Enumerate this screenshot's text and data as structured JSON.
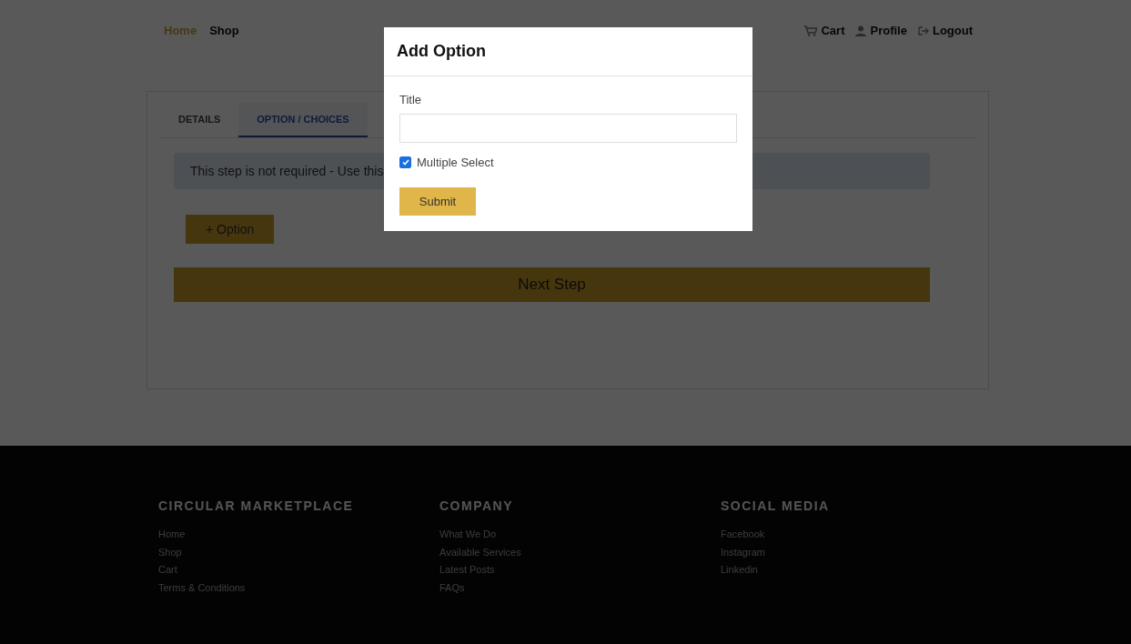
{
  "nav": {
    "links": [
      {
        "label": "Home",
        "selected": true
      },
      {
        "label": "Shop",
        "selected": false
      }
    ],
    "actions": [
      {
        "label": "Cart",
        "kind": "cart"
      },
      {
        "label": "Profile",
        "kind": "profile"
      },
      {
        "label": "Logout",
        "kind": "logout"
      }
    ]
  },
  "tabs": [
    {
      "label": "DETAILS",
      "selected": false
    },
    {
      "label": "OPTION / CHOICES",
      "selected": true
    }
  ],
  "alert": "This step is not required - Use this",
  "add_option_button": "+ Option",
  "next_button": "Next Step",
  "modal": {
    "title": "Add Option",
    "field": {
      "label": "Title"
    },
    "multiple_select": {
      "label": "Multiple Select",
      "checked": true
    },
    "submit": "Submit"
  },
  "footer": {
    "columns": [
      {
        "heading": "CIRCULAR MARKETPLACE",
        "links": [
          "Home",
          "Shop",
          "Cart",
          "Terms & Conditions"
        ]
      },
      {
        "heading": "COMPANY",
        "links": [
          "What We Do",
          "Available Services",
          "Latest Posts",
          "FAQs"
        ]
      },
      {
        "heading": "SOCIAL MEDIA",
        "links": [
          "Facebook",
          "Instagram",
          "Linkedin"
        ]
      }
    ]
  }
}
